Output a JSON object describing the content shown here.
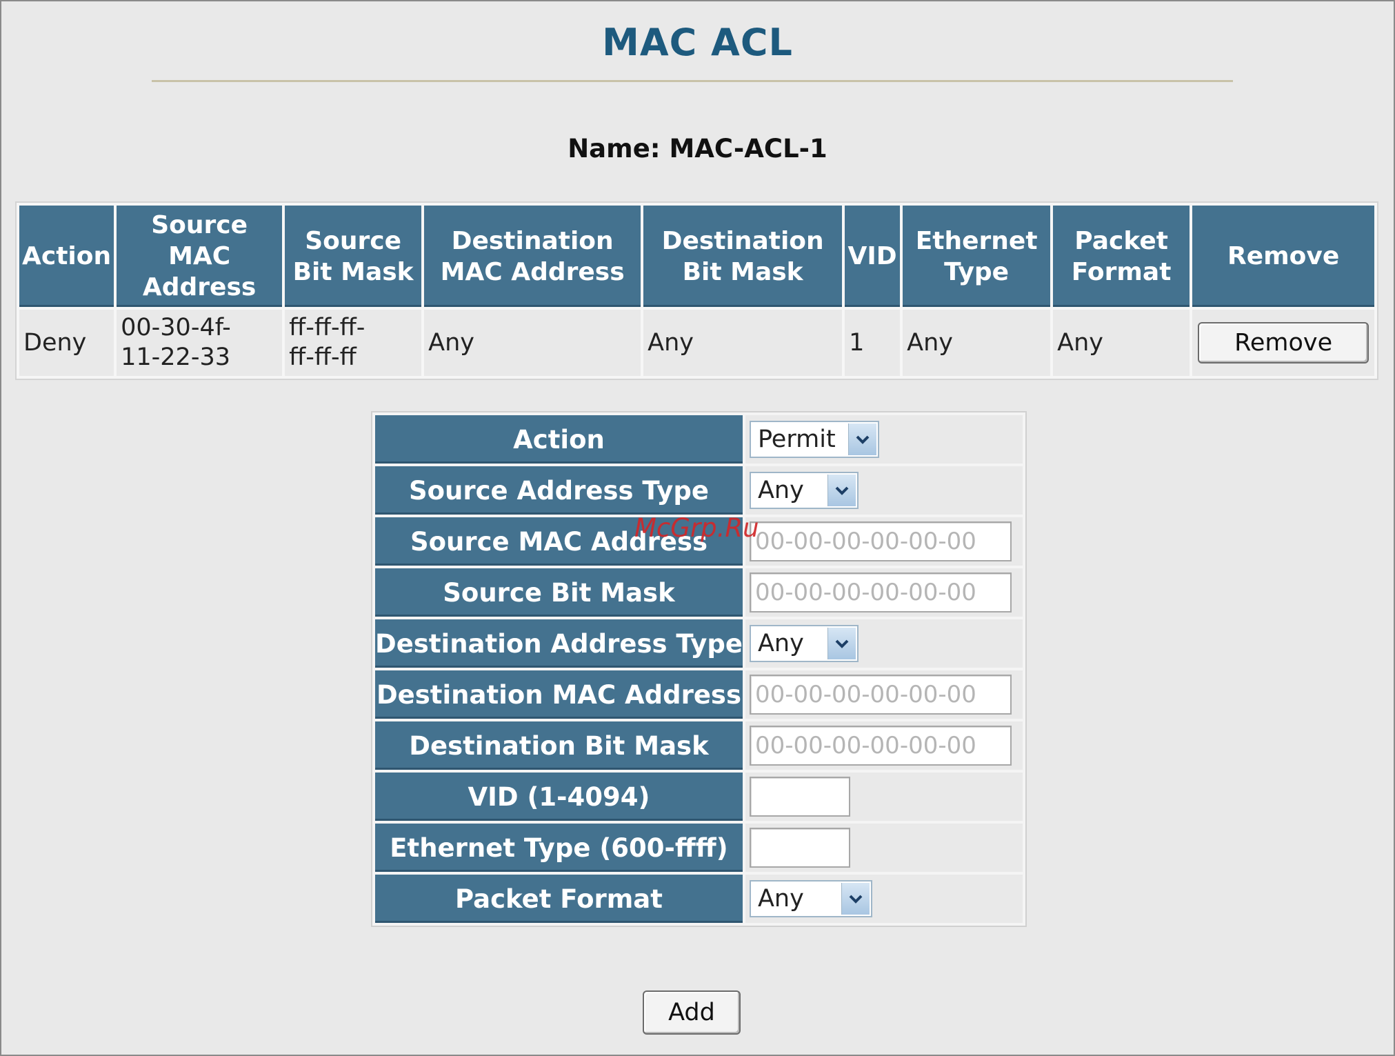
{
  "page": {
    "title": "MAC ACL",
    "name_line": "Name: MAC-ACL-1"
  },
  "rules_table": {
    "headers": {
      "action": "Action",
      "src_mac": "Source MAC Address",
      "src_mask": "Source Bit Mask",
      "dst_mac": "Destination MAC Address",
      "dst_mask": "Destination Bit Mask",
      "vid": "VID",
      "eth_type": "Ethernet Type",
      "pkt_format": "Packet Format",
      "remove": "Remove"
    },
    "rows": [
      {
        "action": "Deny",
        "src_mac_1": "00-30-4f-",
        "src_mac_2": "11-22-33",
        "src_mask_1": "ff-ff-ff-",
        "src_mask_2": "ff-ff-ff",
        "dst_mac": "Any",
        "dst_mask": "Any",
        "vid": "1",
        "eth_type": "Any",
        "pkt_format": "Any",
        "remove_label": "Remove"
      }
    ]
  },
  "form": {
    "action": {
      "label": "Action",
      "value": "Permit"
    },
    "src_addr_type": {
      "label": "Source Address Type",
      "value": "Any"
    },
    "src_mac": {
      "label": "Source MAC Address",
      "placeholder": "00-00-00-00-00-00"
    },
    "src_mask": {
      "label": "Source Bit Mask",
      "placeholder": "00-00-00-00-00-00"
    },
    "dst_addr_type": {
      "label": "Destination Address Type",
      "value": "Any"
    },
    "dst_mac": {
      "label": "Destination MAC Address",
      "placeholder": "00-00-00-00-00-00"
    },
    "dst_mask": {
      "label": "Destination Bit Mask",
      "placeholder": "00-00-00-00-00-00"
    },
    "vid": {
      "label": "VID (1-4094)",
      "value": ""
    },
    "eth_type": {
      "label": "Ethernet Type (600-ffff)",
      "value": ""
    },
    "pkt_format": {
      "label": "Packet Format",
      "value": "Any"
    },
    "add_label": "Add"
  },
  "watermark": "McGrp.Ru",
  "colors": {
    "header_bg": "#44728f",
    "title": "#1d5a7e",
    "page_bg": "#e9e9e9",
    "watermark": "#d0282a"
  },
  "icons": {
    "select_arrow": "chevron-down-icon"
  }
}
